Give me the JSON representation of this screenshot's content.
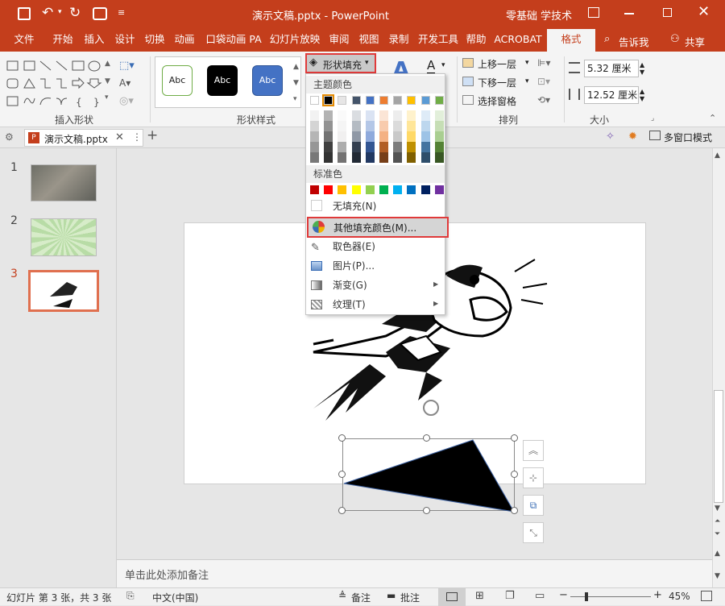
{
  "titlebar": {
    "doc_title": "演示文稿.pptx  -  PowerPoint",
    "user": "零基础 学技术"
  },
  "tabs": [
    {
      "label": "文件"
    },
    {
      "label": "开始"
    },
    {
      "label": "插入"
    },
    {
      "label": "设计"
    },
    {
      "label": "切换"
    },
    {
      "label": "动画"
    },
    {
      "label": "口袋动画 PA"
    },
    {
      "label": "幻灯片放映"
    },
    {
      "label": "审阅"
    },
    {
      "label": "视图"
    },
    {
      "label": "录制"
    },
    {
      "label": "开发工具"
    },
    {
      "label": "帮助"
    },
    {
      "label": "ACROBAT"
    },
    {
      "label": "格式"
    }
  ],
  "tell_me": "告诉我",
  "share": "共享",
  "ribbon": {
    "insert_shapes_label": "插入形状",
    "shape_styles_label": "形状样式",
    "arrange_label": "排列",
    "size_label": "大小",
    "style_preset_text": "Abc",
    "shape_fill_label": "形状填充",
    "bring_forward": "上移一层",
    "send_backward": "下移一层",
    "selection_pane": "选择窗格",
    "height_value": "5.32 厘米",
    "width_value": "12.52 厘米"
  },
  "doctab": {
    "name": "演示文稿.pptx",
    "multiwindow": "多窗口模式"
  },
  "slides": [
    {
      "num": "1"
    },
    {
      "num": "2"
    },
    {
      "num": "3"
    }
  ],
  "dropdown": {
    "theme_colors_label": "主题颜色",
    "standard_colors_label": "标准色",
    "no_fill": "无填充(N)",
    "more_colors": "其他填充颜色(M)...",
    "eyedropper": "取色器(E)",
    "picture": "图片(P)...",
    "gradient": "渐变(G)",
    "texture": "纹理(T)",
    "theme_row": [
      "#ffffff",
      "#000000",
      "#e7e6e6",
      "#44546a",
      "#4472c4",
      "#ed7d31",
      "#a5a5a5",
      "#ffc000",
      "#5b9bd5",
      "#70ad47"
    ],
    "standard_row": [
      "#c00000",
      "#ff0000",
      "#ffc000",
      "#ffff00",
      "#92d050",
      "#00b050",
      "#00b0f0",
      "#0070c0",
      "#002060",
      "#7030a0"
    ]
  },
  "notes_placeholder": "单击此处添加备注",
  "status": {
    "slide_info": "幻灯片 第 3 张，共 3 张",
    "language": "中文(中国)",
    "notes": "备注",
    "comments": "批注",
    "zoom": "45%"
  },
  "colors": {
    "accent": "#c43e1c",
    "highlight": "#e03a3a"
  }
}
